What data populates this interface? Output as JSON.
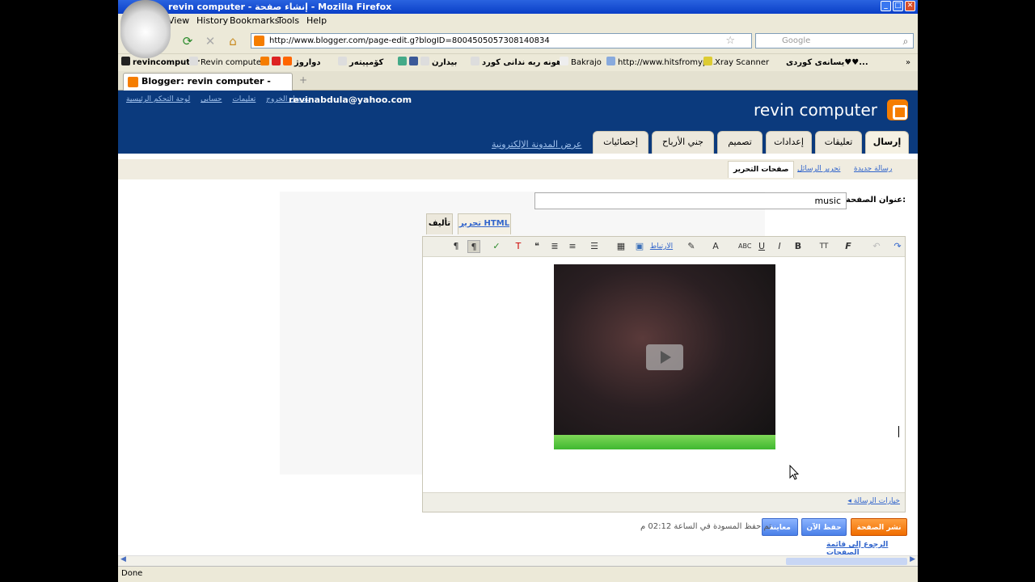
{
  "window": {
    "title": "revin computer - إنشاء صفحة - Mozilla Firefox",
    "controls": [
      "_",
      "□",
      "✕"
    ]
  },
  "menu": {
    "items": [
      "View",
      "History",
      "Bookmarks",
      "Tools",
      "Help"
    ]
  },
  "nav": {
    "url": "http://www.blogger.com/page-edit.g?blogID=8004505057308140834",
    "search_placeholder": "Google"
  },
  "bookmarks": {
    "items": [
      "revincomputer",
      "Revin computer",
      "دواروژ",
      "کۆمپیتەر",
      "بیدارن",
      "هونه ربه ندانی کورد",
      "Bakrajo",
      "http://www.hitsfromyp...",
      "Xray Scanner",
      "یسانەی کوردی♥♥..."
    ]
  },
  "tab": {
    "label": "Blogger: revin computer - إنشاء صفحة",
    "new_tab": "+"
  },
  "header": {
    "toplinks": [
      "تسجيل الخروج",
      "تعليمات",
      "حسابي",
      "لوحة التحكم الرئيسية"
    ],
    "email": "revinabdula@yahoo.com",
    "blog_title": "revin computer",
    "view_blog": "عرض المدونة الإلكترونية",
    "tabs": [
      "إرسال",
      "تعليقات",
      "إعدادات",
      "تصميم",
      "جني الأرباح",
      "إحصائيات"
    ]
  },
  "subnav": {
    "new_post": "رسالة جديدة",
    "edit_posts": "تحرير الرسائل",
    "edit_pages": "صفحات التحرير"
  },
  "editor": {
    "page_title_label": "عنوان الصفحة:",
    "page_title_value": "music",
    "mode_compose": "تأليف",
    "mode_html": "تحرير HTML",
    "toolbar_link": "الارتباط",
    "post_options": "خيارات الرسالة"
  },
  "actions": {
    "publish": "نشر الصفحة",
    "save": "حفظ الآن",
    "preview": "معاينة",
    "draft_message": "تم حفظ المسودة في الساعة 02:12 م",
    "back_link": "الرجوع إلى قائمة الصفحات"
  },
  "status": {
    "text": "Done"
  },
  "colors": {
    "header_bg": "#0b3a7d",
    "publish": "#f06d00",
    "save": "#4a80e8"
  }
}
